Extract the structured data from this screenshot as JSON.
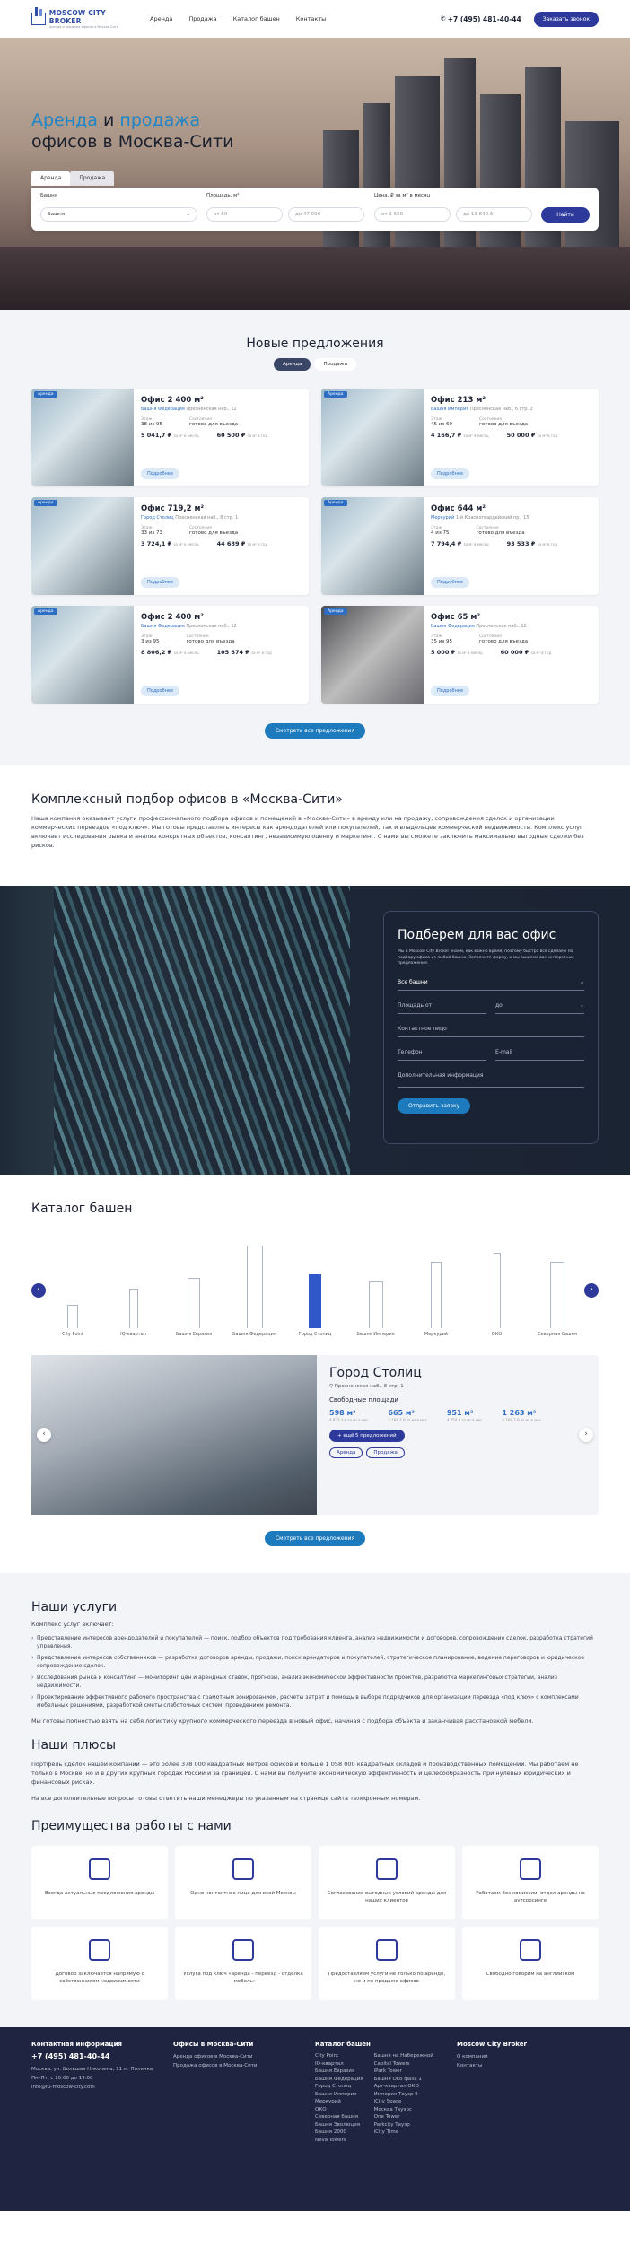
{
  "header": {
    "logo": "MOSCOW CITY BROKER",
    "logo_sub": "Аренда и продажа офисов в Москва-Сити",
    "nav": [
      "Аренда",
      "Продажа",
      "Каталог башен",
      "Контакты"
    ],
    "phone": "+7 (495) 481-40-44",
    "cta": "Заказать звонок"
  },
  "hero": {
    "title_1": "Аренда",
    "title_and": " и ",
    "title_2": "продажа",
    "title_3": "офисов в Москва-Сити",
    "tabs": [
      "Аренда",
      "Продажа"
    ],
    "search": {
      "tower_label": "Башня",
      "tower_value": "Башня",
      "area_label": "Площадь, м²",
      "area_from": "от 50",
      "area_to": "до 47 000",
      "price_label": "Цена, ₽ за м² в месяц",
      "price_from": "от 1 650",
      "price_to": "до 13 840.6",
      "button": "Найти"
    }
  },
  "offers": {
    "title": "Новые предложения",
    "tabs": [
      "Аренда",
      "Продажа"
    ],
    "badge": "Аренда",
    "floor_label": "Этаж",
    "state_label": "Состояние",
    "more": "Подробнее",
    "all": "Смотреть все предложения",
    "items": [
      {
        "title": "Офис 2 400 м²",
        "tower": "Башня Федерация",
        "addr": "Пресненская наб., 12",
        "floor": "38 из 95",
        "state": "готово для въезда",
        "p1": "5 041,7 ₽",
        "p1u": "за м² в месяц",
        "p2": "60 500 ₽",
        "p2u": "за м² в год"
      },
      {
        "title": "Офис 213 м²",
        "tower": "Башня Империя",
        "addr": "Пресненская наб., 6 стр. 2",
        "floor": "45 из 60",
        "state": "готово для въезда",
        "p1": "4 166,7 ₽",
        "p1u": "за м² в месяц",
        "p2": "50 000 ₽",
        "p2u": "за м² в год"
      },
      {
        "title": "Офис 719,2 м²",
        "tower": "Город Столиц",
        "addr": "Пресненская наб., 8 стр. 1",
        "floor": "33 из 73",
        "state": "готово для въезда",
        "p1": "3 724,1 ₽",
        "p1u": "за м² в месяц",
        "p2": "44 689 ₽",
        "p2u": "за м² в год"
      },
      {
        "title": "Офис 644 м²",
        "tower": "Меркурий",
        "addr": "1-й Красногвардейский пр., 15",
        "floor": "4 из 75",
        "state": "готово для въезда",
        "p1": "7 794,4 ₽",
        "p1u": "за м² в месяц",
        "p2": "93 533 ₽",
        "p2u": "за м² в год"
      },
      {
        "title": "Офис 2 400 м²",
        "tower": "Башня Федерация",
        "addr": "Пресненская наб., 12",
        "floor": "3 из 95",
        "state": "готово для въезда",
        "p1": "8 806,2 ₽",
        "p1u": "за м² в месяц",
        "p2": "105 674 ₽",
        "p2u": "за м² в год"
      },
      {
        "title": "Офис 65 м²",
        "tower": "Башня Федерация",
        "addr": "Пресненская наб., 12",
        "floor": "35 из 95",
        "state": "готово для въезда",
        "p1": "5 000 ₽",
        "p1u": "за м² в месяц",
        "p2": "60 000 ₽",
        "p2u": "за м² в год"
      }
    ]
  },
  "complex": {
    "title": "Комплексный подбор офисов в «Москва-Сити»",
    "text": "Наша компания оказывает услуги профессионального подбора офисов и помещений в «Москва-Сити» в аренду или на продажу, сопровождения сделок и организации коммерческих переездов «под ключ». Мы готовы представлять интересы как арендодателей или покупателей, так и владельцев коммерческой недвижимости. Комплекс услуг включает исследования рынка и анализ конкретных объектов, консалтинг, независимую оценку и маркетинг. С нами вы сможете заключить максимально выгодные сделки без рисков."
  },
  "form": {
    "title": "Подберем для вас офис",
    "text": "Мы в Moscow City Broker знаем, как важно время, поэтому быстро все сделаем по подбору офиса из любой башни. Заполните форму, и мы вышлем вам интересные предложения.",
    "tower": "Все башни",
    "area": "Площадь от",
    "to": "до",
    "name": "Контактное лицо",
    "phone": "Телефон",
    "email": "E-mail",
    "extra": "Дополнительная информация",
    "button": "Отправить заявку"
  },
  "catalog": {
    "title": "Каталог башен",
    "towers": [
      "City Point",
      "IQ-квартал",
      "Башня Евразия",
      "Башня Федерация",
      "Город Столиц",
      "Башня Империя",
      "Меркурий",
      "ОКО",
      "Северная башня"
    ],
    "feature": {
      "title": "Город Столиц",
      "addr": "Пресненская наб., 8 стр. 1",
      "sub": "Свободные площади",
      "areas": [
        {
          "v": "598 м²",
          "p": "4 833,3 ₽ за м² в мес"
        },
        {
          "v": "665 м²",
          "p": "5 166,7 ₽ за м² в мес"
        },
        {
          "v": "951 м²",
          "p": "4 750 ₽ за м² в мес"
        },
        {
          "v": "1 263 м²",
          "p": "5 166,7 ₽ за м² в мес"
        }
      ],
      "more": "+ ещё 5 предложений",
      "chips": [
        "Аренда",
        "Продажа"
      ]
    },
    "all": "Смотреть все предложения"
  },
  "services": {
    "title": "Наши услуги",
    "intro": "Комплекс услуг включает:",
    "items": [
      "Представление интересов арендодателей и покупателей — поиск, подбор объектов под требования клиента, анализ недвижимости и договоров, сопровождение сделок, разработка стратегий управления.",
      "Представление интересов собственников — разработка договоров аренды, продажи, поиск арендаторов и покупателей, стратегическое планирование, ведение переговоров и юридическое сопровождение сделок.",
      "Исследования рынка и консалтинг — мониторинг цен и арендных ставок, прогнозы, анализ экономической эффективности проектов, разработка маркетинговых стратегий, анализ недвижимости.",
      "Проектирование эффективного рабочего пространства с грамотным зонированием, расчеты затрат и помощь в выборе подрядчиков для организации переезда «под ключ» с комплексами мебельных решениями, разработкой сметы слаботочных систем, проведением ремонта."
    ],
    "outro": "Мы готовы полностью взять на себя логистику крупного коммерческого переезда в новый офис, начиная с подбора объекта и заканчивая расстановкой мебели."
  },
  "plus": {
    "title": "Наши плюсы",
    "p1": "Портфель сделок нашей компании — это более 378 000 квадратных метров офисов и больше 1 058 000 квадратных складов и производственных помещений. Мы работаем не только в Москве, но и в других крупных городах России и за границей. С нами вы получите экономическую эффективность и целесообразность при нулевых юридических и финансовых рисках.",
    "p2": "На все дополнительные вопросы готовы ответить наши менеджеры по указанным на странице сайта телефонным номерам."
  },
  "advantages": {
    "title": "Преимущества работы с нами",
    "items": [
      {
        "icon": "building-icon",
        "text": "Всегда актуальные предложения аренды"
      },
      {
        "icon": "person-icon",
        "text": "Одно контактное лицо для всей Москвы"
      },
      {
        "icon": "handshake-icon",
        "text": "Согласование выгодных условий аренды для наших клиентов"
      },
      {
        "icon": "money-icon",
        "text": "Работаем без комиссии, отдел аренды на аутсорсинге"
      },
      {
        "icon": "document-icon",
        "text": "Договор заключается напрямую с собственником недвижимости"
      },
      {
        "icon": "desk-icon",
        "text": "Услуга под ключ «аренда - переезд - отделка - мебель»"
      },
      {
        "icon": "home-icon",
        "text": "Предоставляем услуги не только по аренде, но и по продаже офисов"
      },
      {
        "icon": "eng-icon",
        "text": "Свободно говорим на английском"
      }
    ]
  },
  "footer": {
    "contact_title": "Контактная информация",
    "phone": "+7 (495) 481-40-44",
    "address": "Москва, ул. Большая Николина, 11 м. Полянка",
    "hours": "Пн–Пт, с 10:00 до 19:00",
    "email": "info@ru-moscow-city.com",
    "offices_title": "Офисы в Москва-Сити",
    "offices": [
      "Аренда офисов в Москва-Сити",
      "Продажа офисов в Москва-Сити"
    ],
    "catalog_title": "Каталог башен",
    "cat1": [
      "City Point",
      "IQ-квартал",
      "Башня Евразия",
      "Башня Федерация",
      "Город Столиц",
      "Башня Империя",
      "Меркурий",
      "ОКО",
      "Северная башня",
      "Башня Эволюция",
      "Башня 2000",
      "Neva Towers"
    ],
    "cat2": [
      "Башня на Набережной",
      "Capital Towers",
      "iPark Tower",
      "Башня Око фаза 1",
      "Арт-квартал ОКО",
      "Империя Тауэр II",
      "iCity Space",
      "Москва Тауэрс",
      "One Tower",
      "Parkcity Тауэр",
      "iCity Time"
    ],
    "broker_title": "Moscow City Broker",
    "broker": [
      "О компании",
      "Контакты"
    ]
  }
}
